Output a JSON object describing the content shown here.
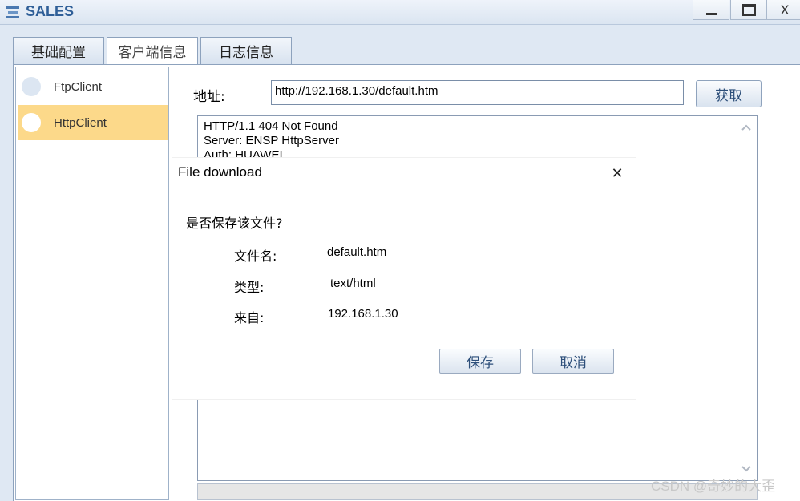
{
  "window": {
    "title": "SALES",
    "close_label": "X"
  },
  "tabs": [
    {
      "label": "基础配置"
    },
    {
      "label": "客户端信息"
    },
    {
      "label": "日志信息"
    }
  ],
  "sidebar": {
    "items": [
      {
        "label": "FtpClient"
      },
      {
        "label": "HttpClient"
      }
    ]
  },
  "address": {
    "label": "地址:",
    "value": "http://192.168.1.30/default.htm",
    "fetch_label": "获取"
  },
  "response": {
    "lines": [
      "HTTP/1.1 404 Not Found",
      "Server: ENSP HttpServer",
      "Auth: HUAWEI"
    ]
  },
  "dialog": {
    "title": "File download",
    "close_glyph": "✕",
    "question": "是否保存该文件?",
    "fields": [
      {
        "key": "文件名:",
        "value": "default.htm"
      },
      {
        "key": "类型:",
        "value": "text/html"
      },
      {
        "key": "来自:",
        "value": "192.168.1.30"
      }
    ],
    "save_label": "保存",
    "cancel_label": "取消"
  },
  "watermark": "CSDN @奇妙的大歪",
  "colors": {
    "accent": "#2f5f98",
    "selected": "#fcd98a"
  }
}
